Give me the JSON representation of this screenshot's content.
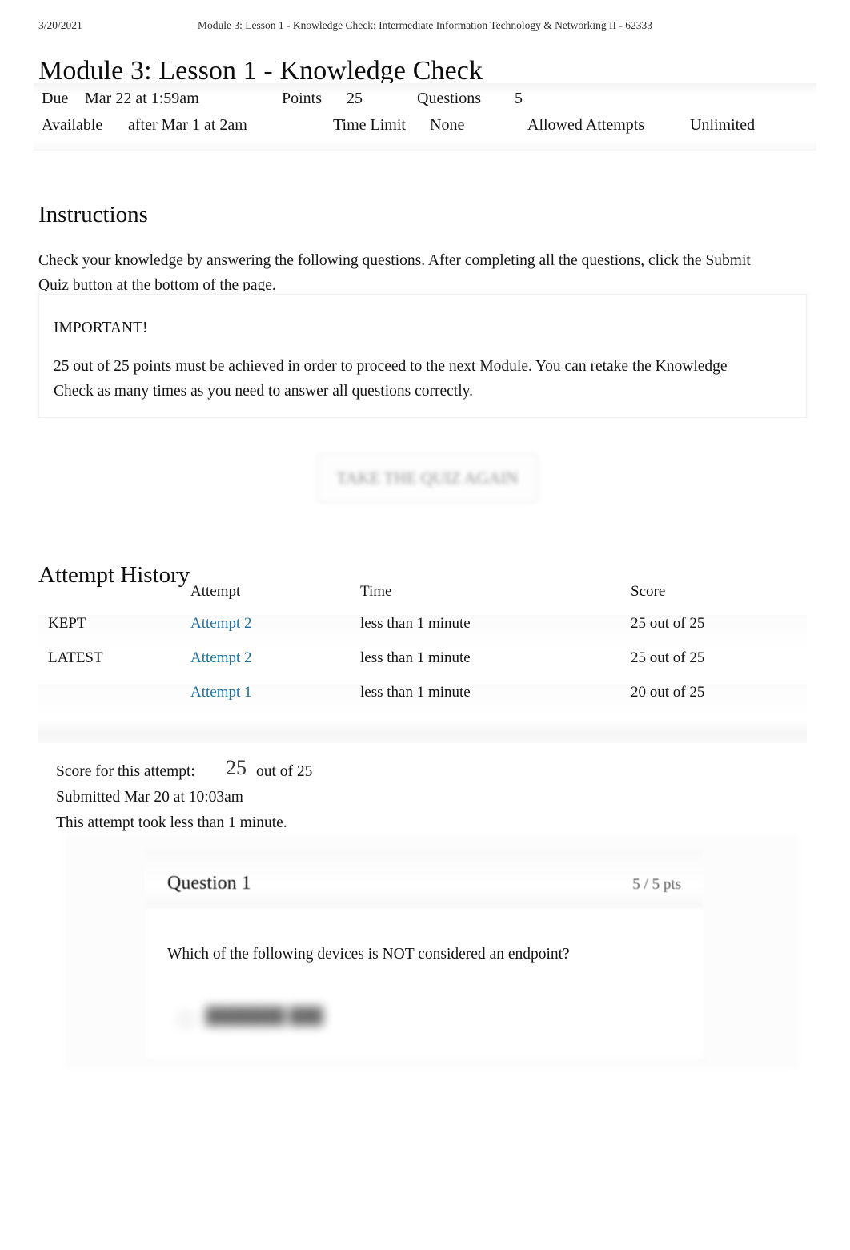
{
  "print_header": {
    "date": "3/20/2021",
    "document_title": "Module 3: Lesson 1 - Knowledge Check: Intermediate Information Technology & Networking II - 62333"
  },
  "page": {
    "title": "Module 3: Lesson 1 - Knowledge Check"
  },
  "quiz_meta": {
    "due_label": "Due",
    "due_value": "Mar 22 at 1:59am",
    "points_label": "Points",
    "points_value": "25",
    "questions_label": "Questions",
    "questions_value": "5",
    "available_label": "Available",
    "available_value": "after Mar 1 at 2am",
    "time_limit_label": "Time Limit",
    "time_limit_value": "None",
    "allowed_attempts_label": "Allowed Attempts",
    "allowed_attempts_value": "Unlimited"
  },
  "instructions": {
    "heading": "Instructions",
    "body": "Check your knowledge by answering the following questions. After completing all the questions, click the Submit Quiz button at the bottom of the page.",
    "callout_title": "IMPORTANT!",
    "callout_body": "25 out of 25 points must be achieved in order to proceed to the next Module. You can retake the Knowledge Check as many times as you need to answer all questions correctly."
  },
  "actions": {
    "retake_label": "TAKE THE QUIZ AGAIN"
  },
  "attempt_history": {
    "heading": "Attempt History",
    "columns": [
      "",
      "Attempt",
      "Time",
      "Score"
    ],
    "rows": [
      {
        "label": "KEPT",
        "attempt": "Attempt 2",
        "time": "less than 1 minute",
        "score": "25 out of 25"
      },
      {
        "label": "LATEST",
        "attempt": "Attempt 2",
        "time": "less than 1 minute",
        "score": "25 out of 25"
      },
      {
        "label": "",
        "attempt": "Attempt 1",
        "time": "less than 1 minute",
        "score": "20 out of 25"
      }
    ]
  },
  "attempt_summary": {
    "score_label": "Score for this attempt:",
    "score_value": "25",
    "score_outof": "out of 25",
    "submitted": "Submitted Mar 20 at 10:03am",
    "duration": "This attempt took less than 1 minute."
  },
  "question": {
    "title": "Question 1",
    "points": "5 / 5 pts",
    "text": "Which of the following devices is NOT considered an endpoint?",
    "answer_redacted": "███████ ███"
  },
  "colors": {
    "link": "#1d6f9f",
    "text": "#141414",
    "muted": "#8c8c8c",
    "band": "#f3f3f3"
  }
}
